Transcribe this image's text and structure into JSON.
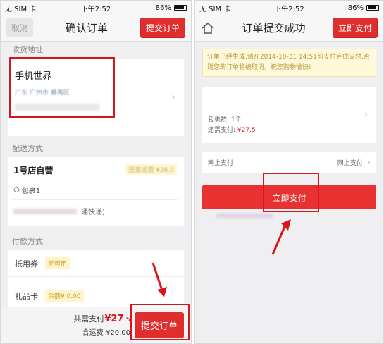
{
  "left": {
    "status": {
      "carrier": "无 SIM 卡",
      "time": "下午2:52",
      "battery": "86%"
    },
    "nav": {
      "cancel": "取消",
      "title": "确认订单",
      "submit": "提交订单"
    },
    "address": {
      "section": "收货地址",
      "name": "手机世界",
      "line": "广东 广州市 番禺区"
    },
    "shipping": {
      "section": "配送方式",
      "store": "1号店自营",
      "free_tag": "还差运费 ¥26.0",
      "package": "包裹1",
      "method_suffix": "通快递)"
    },
    "payment": {
      "section": "付款方式",
      "coupon_label": "抵用券",
      "coupon_value": "无可用",
      "giftcard_label": "礼品卡",
      "giftcard_value": "余额¥ 0.00"
    },
    "bottom": {
      "total_label": "共需支付",
      "total_price": "¥27",
      "total_decimal": ".5",
      "shipfee_label": "含运费",
      "shipfee_value": "¥20.00",
      "submit": "提交订单"
    }
  },
  "right": {
    "status": {
      "carrier": "无 SIM 卡",
      "time": "下午2:52",
      "battery": "86%"
    },
    "nav": {
      "title": "订单提交成功",
      "pay_now": "立即支付"
    },
    "notice": "订单已经生成,请在2014-10-31 14:51前支付完成支付,否则您的订单将被取消。祝您购物愉快!",
    "summary": {
      "count_label": "包裹数: 1个",
      "due_label": "还需支付: ",
      "due_value": "¥27.5"
    },
    "payline": {
      "label": "网上支付",
      "value": "网上支付"
    },
    "pay_button": "立即支付"
  },
  "colors": {
    "accent": "#e02e2e",
    "highlight": "#d9151c"
  }
}
